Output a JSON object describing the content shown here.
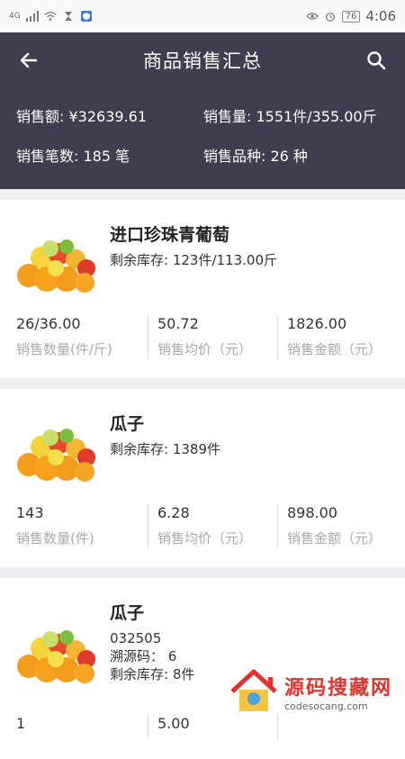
{
  "status_bar": {
    "signal": "4G",
    "battery": "76",
    "time": "4:06"
  },
  "header": {
    "title": "商品销售汇总"
  },
  "summary": {
    "sales_amount": "销售额: ¥32639.61",
    "sales_volume": "销售量: 1551件/355.00斤",
    "sales_count": "销售笔数: 185 笔",
    "sales_kinds": "销售品种: 26 种"
  },
  "products": [
    {
      "name": "进口珍珠青葡萄",
      "lines": [
        "剩余库存: 123件/113.00斤"
      ],
      "metrics": [
        {
          "value": "26/36.00",
          "label": "销售数量(件/斤)"
        },
        {
          "value": "50.72",
          "label": "销售均价（元）"
        },
        {
          "value": "1826.00",
          "label": "销售金额（元）"
        }
      ]
    },
    {
      "name": "瓜子",
      "lines": [
        "剩余库存: 1389件"
      ],
      "metrics": [
        {
          "value": "143",
          "label": "销售数量(件)"
        },
        {
          "value": "6.28",
          "label": "销售均价（元）"
        },
        {
          "value": "898.00",
          "label": "销售金额（元）"
        }
      ]
    },
    {
      "name": "瓜子",
      "lines": [
        "032505",
        "溯源码： 6",
        "剩余库存: 8件"
      ],
      "metrics": [
        {
          "value": "1",
          "label": ""
        },
        {
          "value": "5.00",
          "label": ""
        },
        {
          "value": "",
          "label": ""
        }
      ]
    }
  ],
  "watermark": {
    "text": "源码搜藏网",
    "sub": "codesocang.com"
  }
}
